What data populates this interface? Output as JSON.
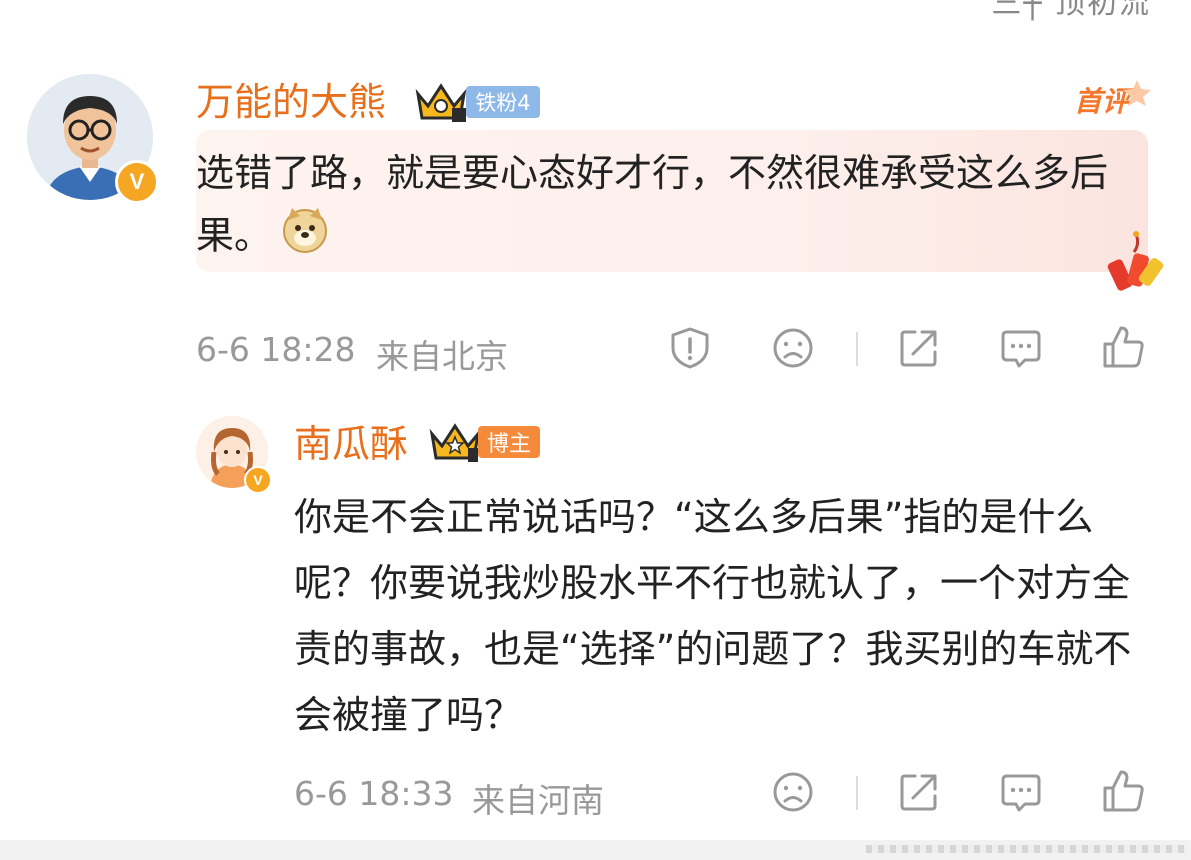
{
  "top_cut_text": "三┼ 顶初流",
  "comment": {
    "username": "万能的大熊",
    "fan_badge": "铁粉4",
    "first_label": "首评",
    "text": "选错了路，就是要心态好才行，不然很难承受这么多后果。",
    "timestamp": "6-6 18:28",
    "location": "来自北京",
    "verified_mark": "V",
    "emoji": "doge-emoji"
  },
  "reply": {
    "username": "南瓜酥",
    "role_badge": "博主",
    "text": "你是不会正常说话吗？“这么多后果”指的是什么呢？你要说我炒股水平不行也就认了，一个对方全责的事故，也是“选择”的问题了？我买别的车就不会被撞了吗？",
    "timestamp": "6-6 18:33",
    "location": "来自河南",
    "verified_mark": "V"
  },
  "icons": [
    "report-icon",
    "dislike-icon",
    "share-icon",
    "comment-icon",
    "like-icon"
  ],
  "colors": {
    "username": "#e86f1b",
    "meta": "#999999",
    "fan_badge": "#8eb8e8",
    "blogger_badge": "#f58b3a",
    "bubble": "#fdf1ed"
  }
}
